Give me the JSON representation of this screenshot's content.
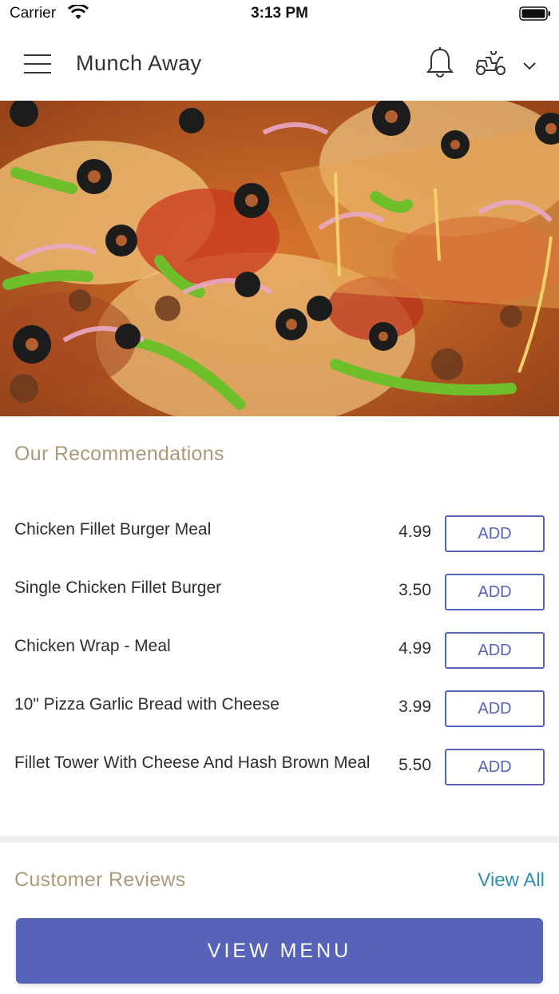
{
  "status_bar": {
    "carrier": "Carrier",
    "time": "3:13 PM"
  },
  "header": {
    "title": "Munch Away",
    "icons": [
      "menu-icon",
      "bell-icon",
      "delivery-scooter-icon",
      "chevron-down-icon"
    ]
  },
  "hero": {
    "image": "pizza-photo"
  },
  "recommendations": {
    "title": "Our Recommendations",
    "items": [
      {
        "name": "Chicken Fillet Burger Meal",
        "price": "4.99",
        "button": "ADD"
      },
      {
        "name": "Single Chicken Fillet Burger",
        "price": "3.50",
        "button": "ADD"
      },
      {
        "name": "Chicken Wrap - Meal",
        "price": "4.99",
        "button": "ADD"
      },
      {
        "name": "10\" Pizza Garlic Bread with Cheese",
        "price": "3.99",
        "button": "ADD"
      },
      {
        "name": "Fillet Tower With Cheese And Hash Brown Meal",
        "price": "5.50",
        "button": "ADD"
      }
    ]
  },
  "reviews": {
    "title": "Customer Reviews",
    "view_all": "View All"
  },
  "footer": {
    "view_menu": "VIEW MENU"
  },
  "colors": {
    "accent": "#5663b9",
    "section_title": "#ab9a7a",
    "link": "#2f8fb5"
  }
}
